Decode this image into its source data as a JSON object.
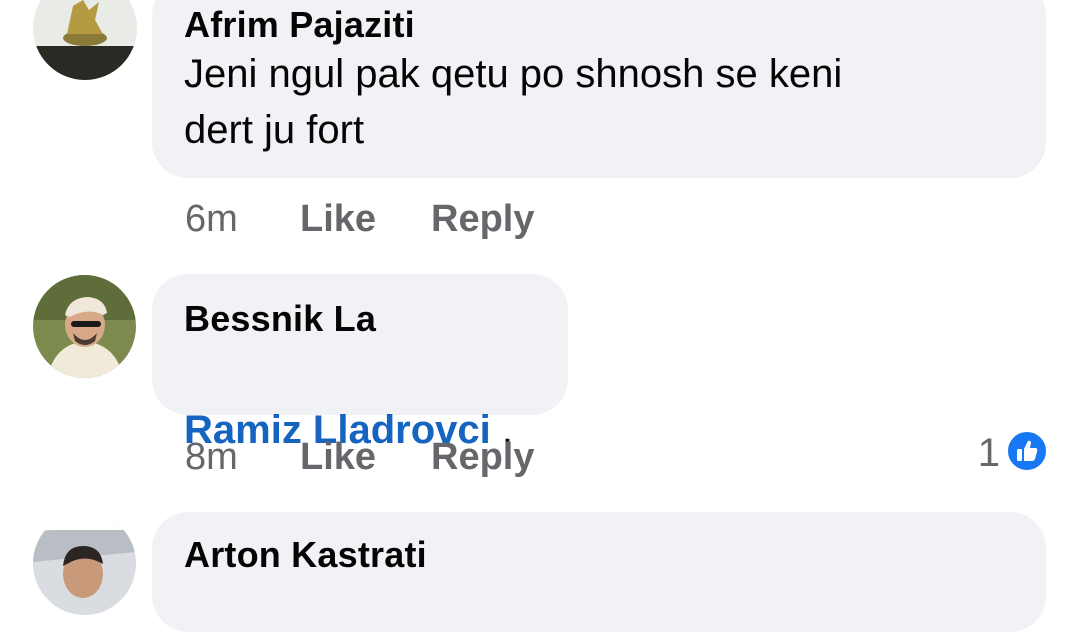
{
  "comments": [
    {
      "author": "Afrim Pajaziti",
      "text": "Jeni ngul pak qetu po shnosh se keni\ndert ju fort",
      "time": "6m",
      "like_label": "Like",
      "reply_label": "Reply",
      "avatar": "statue-photo"
    },
    {
      "author": "Bessnik La",
      "mention": "Ramiz Lladrovci",
      "text_after_mention": " .",
      "time": "8m",
      "like_label": "Like",
      "reply_label": "Reply",
      "reaction_count": "1",
      "reaction_icon": "like-thumb-icon",
      "avatar": "man-cap-photo"
    },
    {
      "author": "Arton Kastrati",
      "avatar": "man-car-photo"
    }
  ],
  "colors": {
    "bubble": "#f0f2f5",
    "mention": "#1565c0",
    "meta": "#65676b",
    "like_blue": "#1877f2"
  }
}
